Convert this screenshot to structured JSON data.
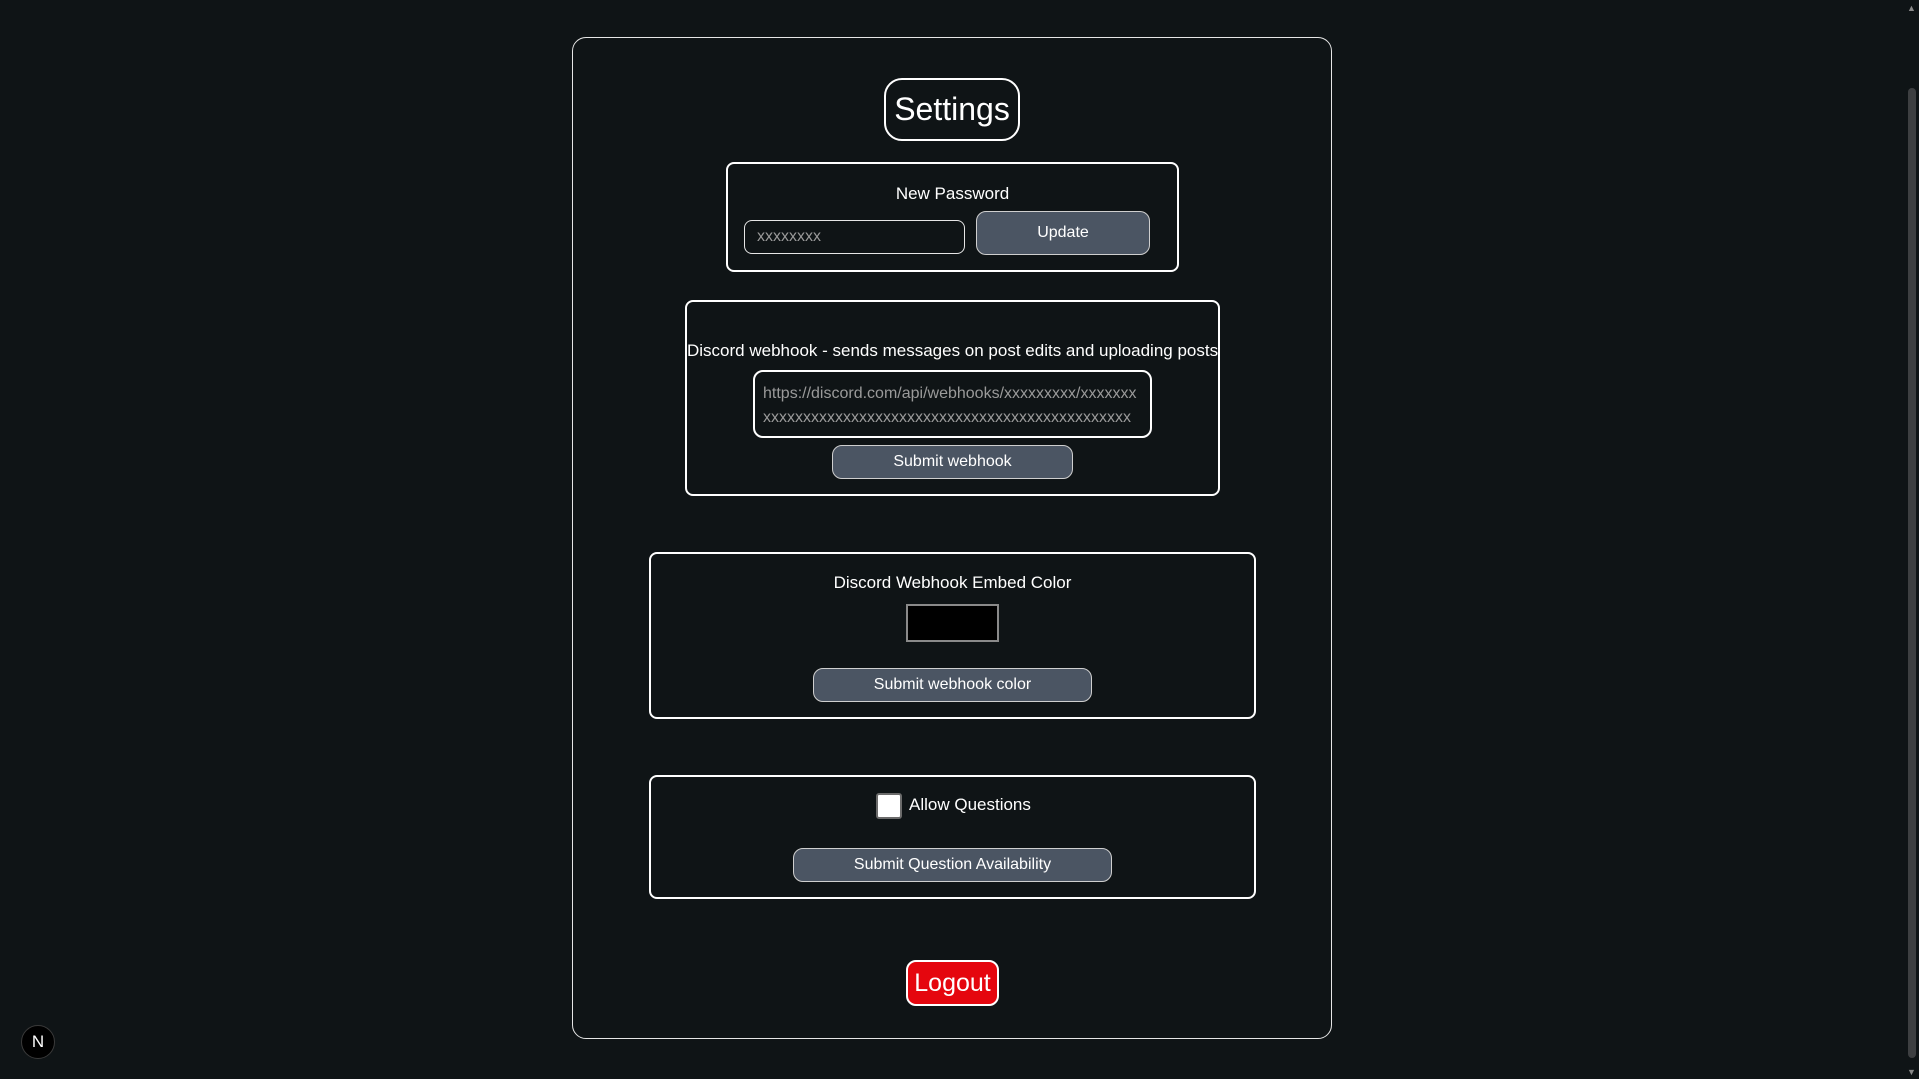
{
  "page": {
    "title": "Settings"
  },
  "password": {
    "label": "New Password",
    "placeholder": "xxxxxxxx",
    "button_label": "Update"
  },
  "webhook": {
    "label": "Discord webhook - sends messages on post edits and uploading posts",
    "placeholder": "https://discord.com/api/webhooks/xxxxxxxxx/xxxxxxxxxxxxxxxxxxxxxxxxxxxxxxxxxxxxxxxxxxxxxxxxxxxxx",
    "button_label": "Submit webhook"
  },
  "embed_color": {
    "label": "Discord Webhook Embed Color",
    "value": "#000000",
    "button_label": "Submit webhook color"
  },
  "questions": {
    "checkbox_label": "Allow Questions",
    "checked": false,
    "button_label": "Submit Question Availability"
  },
  "logout": {
    "label": "Logout",
    "color": "#e5060e"
  },
  "dev_badge": {
    "letter": "N"
  }
}
